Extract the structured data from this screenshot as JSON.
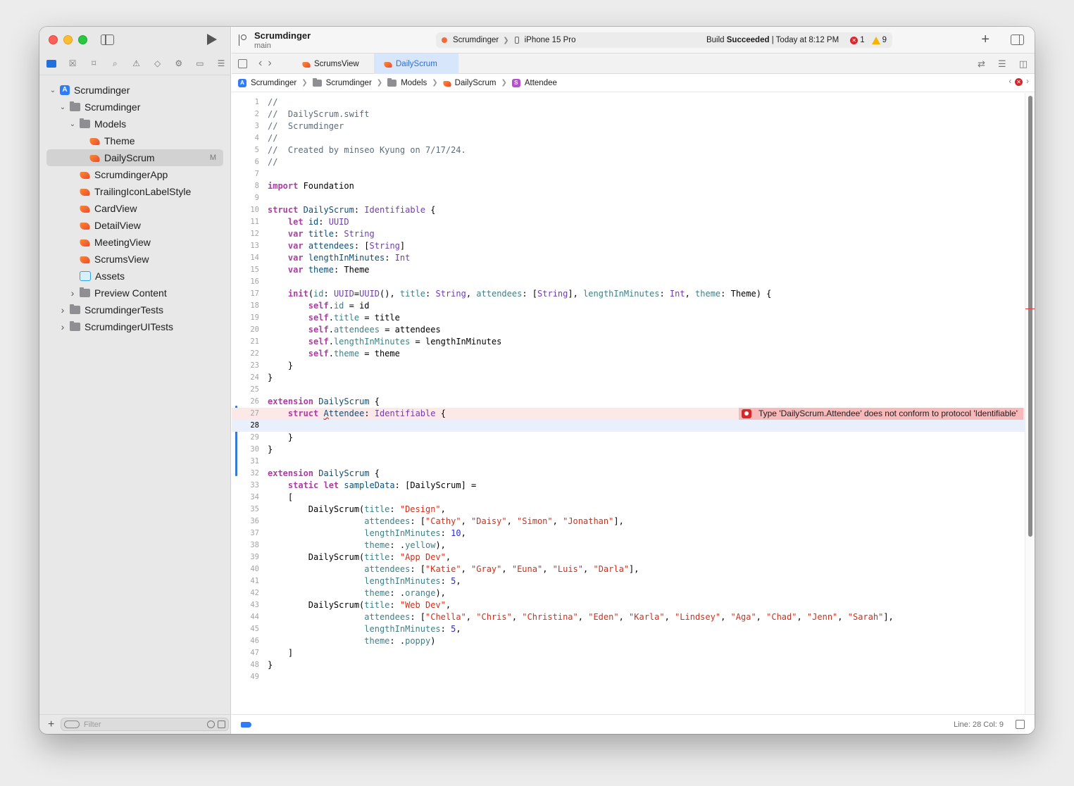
{
  "window": {
    "project_name": "Scrumdinger",
    "branch": "main"
  },
  "activity": {
    "scheme": "Scrumdinger",
    "device": "iPhone 15 Pro",
    "build_status_prefix": "Build",
    "build_status_result": "Succeeded",
    "build_status_time": "| Today at 8:12 PM",
    "error_count": "1",
    "warning_count": "9"
  },
  "navigator": {
    "filter_placeholder": "Filter",
    "items": [
      {
        "label": "Scrumdinger",
        "kind": "project",
        "depth": 0,
        "expanded": true
      },
      {
        "label": "Scrumdinger",
        "kind": "folder",
        "depth": 1,
        "expanded": true
      },
      {
        "label": "Models",
        "kind": "folder",
        "depth": 2,
        "expanded": true
      },
      {
        "label": "Theme",
        "kind": "swift",
        "depth": 3
      },
      {
        "label": "DailyScrum",
        "kind": "swift",
        "depth": 3,
        "selected": true,
        "badge": "M"
      },
      {
        "label": "ScrumdingerApp",
        "kind": "swift",
        "depth": 2
      },
      {
        "label": "TrailingIconLabelStyle",
        "kind": "swift",
        "depth": 2
      },
      {
        "label": "CardView",
        "kind": "swift",
        "depth": 2
      },
      {
        "label": "DetailView",
        "kind": "swift",
        "depth": 2
      },
      {
        "label": "MeetingView",
        "kind": "swift",
        "depth": 2
      },
      {
        "label": "ScrumsView",
        "kind": "swift",
        "depth": 2
      },
      {
        "label": "Assets",
        "kind": "assets",
        "depth": 2
      },
      {
        "label": "Preview Content",
        "kind": "folder",
        "depth": 2,
        "collapsed": true
      },
      {
        "label": "ScrumdingerTests",
        "kind": "folder",
        "depth": 1,
        "collapsed": true
      },
      {
        "label": "ScrumdingerUITests",
        "kind": "folder",
        "depth": 1,
        "collapsed": true
      }
    ]
  },
  "tabs": [
    {
      "label": "ScrumsView",
      "active": false
    },
    {
      "label": "DailyScrum",
      "active": true
    }
  ],
  "breadcrumb": [
    "Scrumdinger",
    "Scrumdinger",
    "Models",
    "DailyScrum",
    "Attendee"
  ],
  "editor": {
    "error_message": "Type 'DailyScrum.Attendee' does not conform to protocol 'Identifiable'",
    "error_line": 27,
    "current_line": 28,
    "lines": [
      [
        [
          "cm",
          "//"
        ]
      ],
      [
        [
          "cm",
          "//  DailyScrum.swift"
        ]
      ],
      [
        [
          "cm",
          "//  Scrumdinger"
        ]
      ],
      [
        [
          "cm",
          "//"
        ]
      ],
      [
        [
          "cm",
          "//  Created by minseo Kyung on 7/17/24."
        ]
      ],
      [
        [
          "cm",
          "//"
        ]
      ],
      [],
      [
        [
          "kw",
          "import"
        ],
        [
          "pl",
          " Foundation"
        ]
      ],
      [],
      [
        [
          "kw",
          "struct"
        ],
        [
          "pl",
          " "
        ],
        [
          "tyd",
          "DailyScrum"
        ],
        [
          "pl",
          ": "
        ],
        [
          "ty",
          "Identifiable"
        ],
        [
          "pl",
          " {"
        ]
      ],
      [
        [
          "pl",
          "    "
        ],
        [
          "kw",
          "let"
        ],
        [
          "pl",
          " "
        ],
        [
          "tyd",
          "id"
        ],
        [
          "pl",
          ": "
        ],
        [
          "ty",
          "UUID"
        ]
      ],
      [
        [
          "pl",
          "    "
        ],
        [
          "kw",
          "var"
        ],
        [
          "pl",
          " "
        ],
        [
          "tyd",
          "title"
        ],
        [
          "pl",
          ": "
        ],
        [
          "ty",
          "String"
        ]
      ],
      [
        [
          "pl",
          "    "
        ],
        [
          "kw",
          "var"
        ],
        [
          "pl",
          " "
        ],
        [
          "tyd",
          "attendees"
        ],
        [
          "pl",
          ": ["
        ],
        [
          "ty",
          "String"
        ],
        [
          "pl",
          "]"
        ]
      ],
      [
        [
          "pl",
          "    "
        ],
        [
          "kw",
          "var"
        ],
        [
          "pl",
          " "
        ],
        [
          "tyd",
          "lengthInMinutes"
        ],
        [
          "pl",
          ": "
        ],
        [
          "ty",
          "Int"
        ]
      ],
      [
        [
          "pl",
          "    "
        ],
        [
          "kw",
          "var"
        ],
        [
          "pl",
          " "
        ],
        [
          "tyd",
          "theme"
        ],
        [
          "pl",
          ": "
        ],
        [
          "pl",
          "Theme"
        ]
      ],
      [],
      [
        [
          "pl",
          "    "
        ],
        [
          "kw",
          "init"
        ],
        [
          "pl",
          "("
        ],
        [
          "pr",
          "id"
        ],
        [
          "pl",
          ": "
        ],
        [
          "ty",
          "UUID"
        ],
        [
          "pl",
          "="
        ],
        [
          "ty",
          "UUID"
        ],
        [
          "pl",
          "(), "
        ],
        [
          "pr",
          "title"
        ],
        [
          "pl",
          ": "
        ],
        [
          "ty",
          "String"
        ],
        [
          "pl",
          ", "
        ],
        [
          "pr",
          "attendees"
        ],
        [
          "pl",
          ": ["
        ],
        [
          "ty",
          "String"
        ],
        [
          "pl",
          "], "
        ],
        [
          "pr",
          "lengthInMinutes"
        ],
        [
          "pl",
          ": "
        ],
        [
          "ty",
          "Int"
        ],
        [
          "pl",
          ", "
        ],
        [
          "pr",
          "theme"
        ],
        [
          "pl",
          ": "
        ],
        [
          "pl",
          "Theme"
        ],
        [
          "pl",
          ") {"
        ]
      ],
      [
        [
          "pl",
          "        "
        ],
        [
          "kw",
          "self"
        ],
        [
          "pl",
          "."
        ],
        [
          "pr",
          "id"
        ],
        [
          "pl",
          " = id"
        ]
      ],
      [
        [
          "pl",
          "        "
        ],
        [
          "kw",
          "self"
        ],
        [
          "pl",
          "."
        ],
        [
          "pr",
          "title"
        ],
        [
          "pl",
          " = title"
        ]
      ],
      [
        [
          "pl",
          "        "
        ],
        [
          "kw",
          "self"
        ],
        [
          "pl",
          "."
        ],
        [
          "pr",
          "attendees"
        ],
        [
          "pl",
          " = attendees"
        ]
      ],
      [
        [
          "pl",
          "        "
        ],
        [
          "kw",
          "self"
        ],
        [
          "pl",
          "."
        ],
        [
          "pr",
          "lengthInMinutes"
        ],
        [
          "pl",
          " = lengthInMinutes"
        ]
      ],
      [
        [
          "pl",
          "        "
        ],
        [
          "kw",
          "self"
        ],
        [
          "pl",
          "."
        ],
        [
          "pr",
          "theme"
        ],
        [
          "pl",
          " = theme"
        ]
      ],
      [
        [
          "pl",
          "    }"
        ]
      ],
      [
        [
          "pl",
          "}"
        ]
      ],
      [],
      [
        [
          "kw",
          "extension"
        ],
        [
          "pl",
          " "
        ],
        [
          "tyd",
          "DailyScrum"
        ],
        [
          "pl",
          " {"
        ]
      ],
      [
        [
          "pl",
          "    "
        ],
        [
          "kw",
          "struct"
        ],
        [
          "pl",
          " "
        ],
        [
          "sq",
          "A"
        ],
        [
          "tyd",
          "ttendee"
        ],
        [
          "pl",
          ": "
        ],
        [
          "ty",
          "Identifiable"
        ],
        [
          "pl",
          " {"
        ]
      ],
      [],
      [
        [
          "pl",
          "    }"
        ]
      ],
      [
        [
          "pl",
          "}"
        ]
      ],
      [],
      [
        [
          "kw",
          "extension"
        ],
        [
          "pl",
          " "
        ],
        [
          "tyd",
          "DailyScrum"
        ],
        [
          "pl",
          " {"
        ]
      ],
      [
        [
          "pl",
          "    "
        ],
        [
          "kw",
          "static let"
        ],
        [
          "pl",
          " "
        ],
        [
          "tyd",
          "sampleData"
        ],
        [
          "pl",
          ": ["
        ],
        [
          "pl",
          "DailyScrum"
        ],
        [
          "pl",
          "] ="
        ]
      ],
      [
        [
          "pl",
          "    ["
        ]
      ],
      [
        [
          "pl",
          "        "
        ],
        [
          "pl",
          "DailyScrum"
        ],
        [
          "pl",
          "("
        ],
        [
          "pr",
          "title"
        ],
        [
          "pl",
          ": "
        ],
        [
          "st",
          "\"Design\""
        ],
        [
          "pl",
          ","
        ]
      ],
      [
        [
          "pl",
          "                   "
        ],
        [
          "pr",
          "attendees"
        ],
        [
          "pl",
          ": ["
        ],
        [
          "st",
          "\"Cathy\""
        ],
        [
          "pl",
          ", "
        ],
        [
          "st",
          "\"Daisy\""
        ],
        [
          "pl",
          ", "
        ],
        [
          "st",
          "\"Simon\""
        ],
        [
          "pl",
          ", "
        ],
        [
          "st",
          "\"Jonathan\""
        ],
        [
          "pl",
          "],"
        ]
      ],
      [
        [
          "pl",
          "                   "
        ],
        [
          "pr",
          "lengthInMinutes"
        ],
        [
          "pl",
          ": "
        ],
        [
          "nm",
          "10"
        ],
        [
          "pl",
          ","
        ]
      ],
      [
        [
          "pl",
          "                   "
        ],
        [
          "pr",
          "theme"
        ],
        [
          "pl",
          ": ."
        ],
        [
          "pr",
          "yellow"
        ],
        [
          "pl",
          "),"
        ]
      ],
      [
        [
          "pl",
          "        "
        ],
        [
          "pl",
          "DailyScrum"
        ],
        [
          "pl",
          "("
        ],
        [
          "pr",
          "title"
        ],
        [
          "pl",
          ": "
        ],
        [
          "st",
          "\"App Dev\""
        ],
        [
          "pl",
          ","
        ]
      ],
      [
        [
          "pl",
          "                   "
        ],
        [
          "pr",
          "attendees"
        ],
        [
          "pl",
          ": ["
        ],
        [
          "st",
          "\"Katie\""
        ],
        [
          "pl",
          ", "
        ],
        [
          "st",
          "\"Gray\""
        ],
        [
          "pl",
          ", "
        ],
        [
          "st",
          "\"Euna\""
        ],
        [
          "pl",
          ", "
        ],
        [
          "st",
          "\"Luis\""
        ],
        [
          "pl",
          ", "
        ],
        [
          "st",
          "\"Darla\""
        ],
        [
          "pl",
          "],"
        ]
      ],
      [
        [
          "pl",
          "                   "
        ],
        [
          "pr",
          "lengthInMinutes"
        ],
        [
          "pl",
          ": "
        ],
        [
          "nm",
          "5"
        ],
        [
          "pl",
          ","
        ]
      ],
      [
        [
          "pl",
          "                   "
        ],
        [
          "pr",
          "theme"
        ],
        [
          "pl",
          ": ."
        ],
        [
          "pr",
          "orange"
        ],
        [
          "pl",
          "),"
        ]
      ],
      [
        [
          "pl",
          "        "
        ],
        [
          "pl",
          "DailyScrum"
        ],
        [
          "pl",
          "("
        ],
        [
          "pr",
          "title"
        ],
        [
          "pl",
          ": "
        ],
        [
          "st",
          "\"Web Dev\""
        ],
        [
          "pl",
          ","
        ]
      ],
      [
        [
          "pl",
          "                   "
        ],
        [
          "pr",
          "attendees"
        ],
        [
          "pl",
          ": ["
        ],
        [
          "st",
          "\"Chella\""
        ],
        [
          "pl",
          ", "
        ],
        [
          "st",
          "\"Chris\""
        ],
        [
          "pl",
          ", "
        ],
        [
          "st",
          "\"Christina\""
        ],
        [
          "pl",
          ", "
        ],
        [
          "st",
          "\"Eden\""
        ],
        [
          "pl",
          ", "
        ],
        [
          "st",
          "\"Karla\""
        ],
        [
          "pl",
          ", "
        ],
        [
          "st",
          "\"Lindsey\""
        ],
        [
          "pl",
          ", "
        ],
        [
          "st",
          "\"Aga\""
        ],
        [
          "pl",
          ", "
        ],
        [
          "st",
          "\"Chad\""
        ],
        [
          "pl",
          ", "
        ],
        [
          "st",
          "\"Jenn\""
        ],
        [
          "pl",
          ", "
        ],
        [
          "st",
          "\"Sarah\""
        ],
        [
          "pl",
          "],"
        ]
      ],
      [
        [
          "pl",
          "                   "
        ],
        [
          "pr",
          "lengthInMinutes"
        ],
        [
          "pl",
          ": "
        ],
        [
          "nm",
          "5"
        ],
        [
          "pl",
          ","
        ]
      ],
      [
        [
          "pl",
          "                   "
        ],
        [
          "pr",
          "theme"
        ],
        [
          "pl",
          ": ."
        ],
        [
          "pr",
          "poppy"
        ],
        [
          "pl",
          ")"
        ]
      ],
      [
        [
          "pl",
          "    ]"
        ]
      ],
      [
        [
          "pl",
          "}"
        ]
      ],
      []
    ]
  },
  "status": {
    "cursor_position": "Line: 28  Col: 9"
  },
  "colors": {
    "accent": "#2f7cf6",
    "error": "#d9262a",
    "warning": "#f5b400",
    "keyword": "#ad3da4",
    "string": "#d12f1b",
    "number": "#272ad8"
  }
}
